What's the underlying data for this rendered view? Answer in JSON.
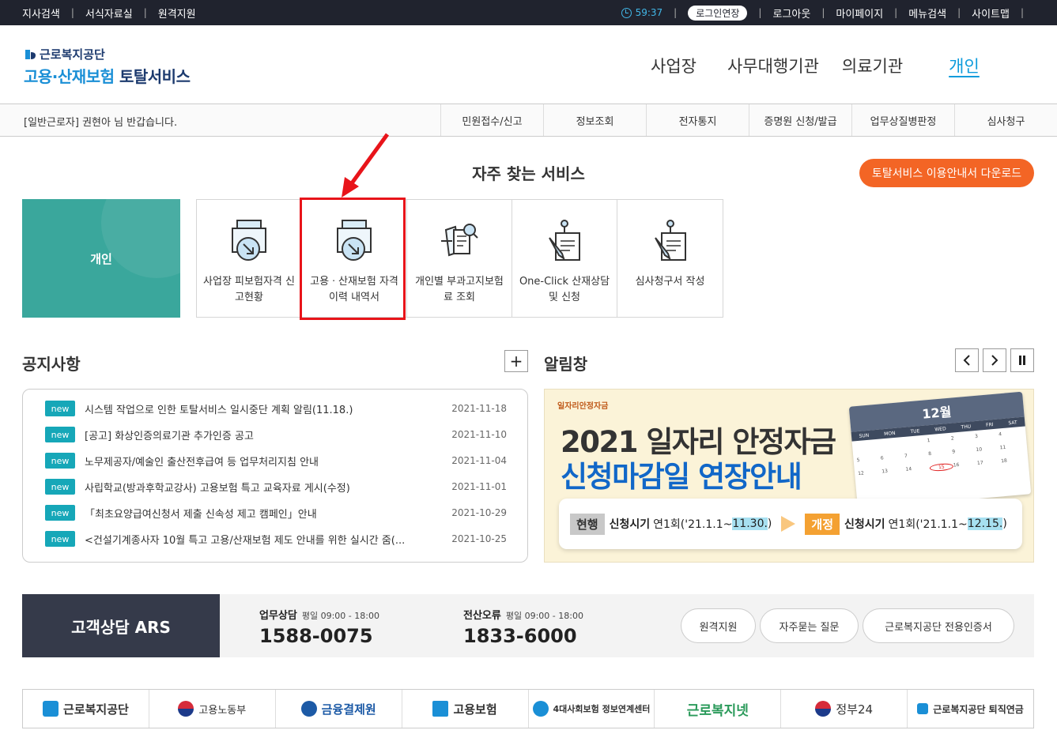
{
  "topbar": {
    "left_links": [
      "지사검색",
      "서식자료실",
      "원격지원"
    ],
    "timer": "59:37",
    "extend_label": "로그인연장",
    "right_links": [
      "로그아웃",
      "마이페이지",
      "메뉴검색",
      "사이트맵"
    ],
    "separator": "|"
  },
  "header": {
    "org_name": "근로복지공단",
    "service_prefix": "고용·산재보험",
    "service_suffix": "토탈서비스",
    "nav": [
      "사업장",
      "사무대행기관",
      "의료기관",
      "개인"
    ],
    "active_nav": "개인"
  },
  "subbar": {
    "greeting": "[일반근로자] 권현아 님 반갑습니다.",
    "menu": [
      "민원접수/신고",
      "정보조회",
      "전자통지",
      "증명원 신청/발급",
      "업무상질병판정",
      "심사청구"
    ]
  },
  "frequent": {
    "title": "자주 찾는 서비스",
    "download_label": "토탈서비스 이용안내서 다운로드",
    "tile_label": "개인",
    "items": [
      {
        "label": "사업장 피보험자격 신고현황",
        "icon": "document-arrow-icon"
      },
      {
        "label": "고용ㆍ산재보험 자격 이력 내역서",
        "icon": "document-arrow-icon"
      },
      {
        "label": "개인별 부과고지보험료 조회",
        "icon": "receipt-search-icon"
      },
      {
        "label": "One-Click 산재상담 및 신청",
        "icon": "pen-document-icon"
      },
      {
        "label": "심사청구서 작성",
        "icon": "pen-document-icon"
      }
    ]
  },
  "notice": {
    "title": "공지사항",
    "more_label": "+",
    "items": [
      {
        "badge": "new",
        "title": "시스템 작업으로 인한 토탈서비스 일시중단 계획 알림(11.18.)",
        "date": "2021-11-18"
      },
      {
        "badge": "new",
        "title": "[공고] 화상인증의료기관 추가인증 공고",
        "date": "2021-11-10"
      },
      {
        "badge": "new",
        "title": "노무제공자/예술인 출산전후급여 등 업무처리지침 안내",
        "date": "2021-11-04"
      },
      {
        "badge": "new",
        "title": "사립학교(방과후학교강사) 고용보험 특고 교육자료 게시(수정)",
        "date": "2021-11-01"
      },
      {
        "badge": "new",
        "title": "「최초요양급여신청서 제출 신속성 제고 캠페인」안내",
        "date": "2021-10-29"
      },
      {
        "badge": "new",
        "title": "<건설기계종사자 10월 특고 고용/산재보험 제도 안내를 위한 실시간 줌(...",
        "date": "2021-10-25"
      }
    ]
  },
  "alert": {
    "title": "알림창",
    "banner": {
      "small_logo": "일자리안정자금",
      "line1": "2021 일자리 안정자금",
      "line2": "신청마감일 연장안내",
      "month": "12월",
      "weekdays": [
        "SUN",
        "MON",
        "TUE",
        "WED",
        "THU",
        "FRI",
        "SAT"
      ],
      "current_tag": "현행",
      "current_label": "신청시기",
      "current_prefix": "연1회('21.1.1~",
      "current_end": "11.30.",
      "new_tag": "개정",
      "new_label": "신청시기",
      "new_prefix": "연1회('21.1.1~",
      "new_end": "12.15.",
      "close_paren": ")"
    }
  },
  "contact": {
    "title": "고객상담 ARS",
    "work_label": "업무상담",
    "work_hours": "평일 09:00 - 18:00",
    "work_number": "1588-0075",
    "it_label": "전산오류",
    "it_hours": "평일 09:00 - 18:00",
    "it_number": "1833-6000",
    "buttons": [
      "원격지원",
      "자주묻는 질문",
      "근로복지공단 전용인증서"
    ]
  },
  "footer_logos": [
    "근로복지공단",
    "고용노동부",
    "금융결제원",
    "고용보험",
    "4대사회보험 정보연계센터",
    "근로복지넷",
    "정부24",
    "근로복지공단 퇴직연금"
  ],
  "colors": {
    "topbar": "#20232e",
    "accent": "#0d9bdc",
    "tile": "#3aa79c",
    "download": "#f36525",
    "badge": "#16a7b8",
    "highlight": "#e8141a"
  }
}
